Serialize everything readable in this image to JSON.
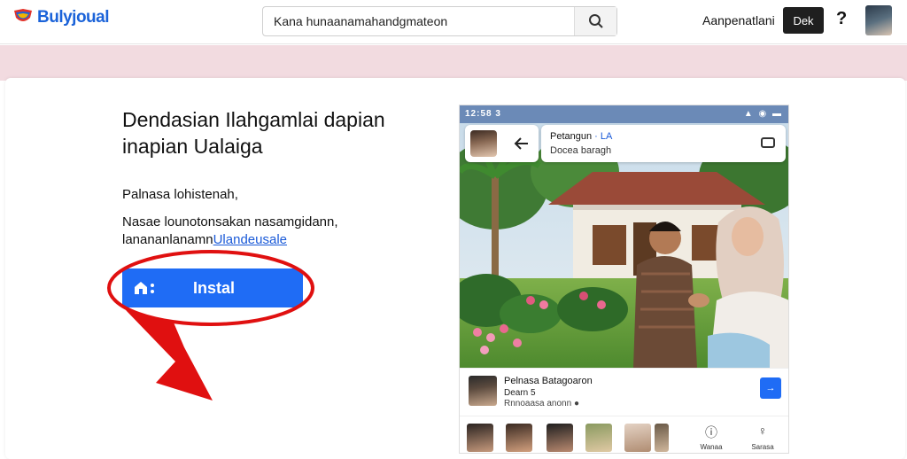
{
  "header": {
    "brand": "Bulyjoual",
    "search_value": "Kana hunaanamahandgmateon",
    "link": "Aanpenatlani",
    "button": "Dek",
    "help": "?"
  },
  "main": {
    "headline": "Dendasian Ilahgamlai dapian inapian Ualaiga",
    "para1": "Palnasa lohistenah,",
    "para2_line1": "Nasae lounotonsakan nasamgidann,",
    "para2_line2_prefix": "lanananlanamn",
    "para2_line2_link": "Ulandeusale",
    "install_label": "Instal"
  },
  "phone": {
    "status_left": "12:58 3",
    "status_right": "▲ ◉ ▬",
    "info_title": "Petangun",
    "info_title_blue": "· LA",
    "info_sub": "Docea baragh",
    "post_title": "Pelnasa Batagoaron",
    "post_sub": "Dearn 5",
    "post_sub2": "Rnnoaasa anonn ●",
    "post_button": "→",
    "nav": [
      {
        "icon": "ⓘ",
        "label": "Wanaa"
      },
      {
        "icon": "♀",
        "label": "Sarasa"
      }
    ]
  },
  "colors": {
    "accent": "#1f6cf5",
    "band": "#f2dbe0",
    "annotation": "#e01010"
  },
  "icons": [
    "logo-icon",
    "search-icon",
    "home-icon",
    "back-arrow-icon",
    "chat-icon",
    "info-icon",
    "person-icon"
  ]
}
